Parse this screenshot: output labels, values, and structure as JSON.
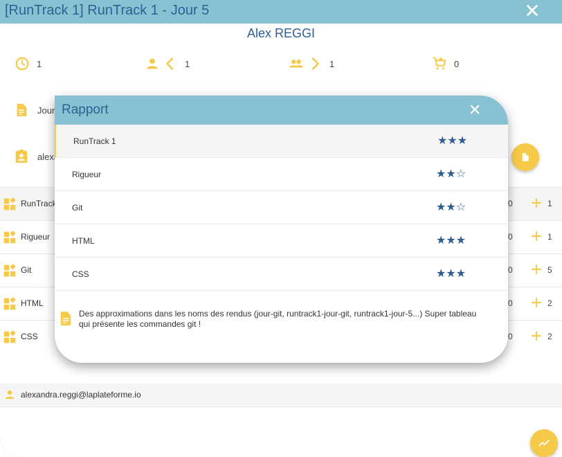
{
  "window": {
    "title": "[RunTrack 1] RunTrack 1 - Jour 5"
  },
  "student": {
    "name": "Alex REGGI",
    "email": "alexandra.reggi@laplateforme.io"
  },
  "stats": [
    {
      "icon": "clock-icon",
      "value": "1"
    },
    {
      "icon": "person-chevron-left-icon",
      "value": "1"
    },
    {
      "icon": "group-chevron-right-icon",
      "value": "1"
    },
    {
      "icon": "cart-plus-icon",
      "value": "0"
    }
  ],
  "info": {
    "doc_label": "Jour",
    "user_label": "alexa"
  },
  "skills_list": [
    {
      "label": "RunTrack",
      "zero": "0",
      "count": "1"
    },
    {
      "label": "Rigueur",
      "zero": "0",
      "count": "1"
    },
    {
      "label": "Git",
      "zero": "0",
      "count": "5"
    },
    {
      "label": "HTML",
      "zero": "0",
      "count": "2"
    },
    {
      "label": "CSS",
      "zero": "0",
      "count": "2"
    }
  ],
  "modal": {
    "title": "Rapport",
    "rows": [
      {
        "label": "RunTrack 1",
        "stars": "★★★",
        "rating": 3
      },
      {
        "label": "Rigueur",
        "stars": "★★☆",
        "rating": 2
      },
      {
        "label": "Git",
        "stars": "★★☆",
        "rating": 2
      },
      {
        "label": "HTML",
        "stars": "★★★",
        "rating": 3
      },
      {
        "label": "CSS",
        "stars": "★★★",
        "rating": 3
      }
    ],
    "comment": "Des approximations dans les noms des rendus (jour-git, runtrack1-jour-git, runtrack1-jour-5...) Super tableau qui présente les commandes git !"
  },
  "colors": {
    "accent": "#f7c948",
    "header": "#88c1d2",
    "primary_text": "#2d5f94"
  }
}
